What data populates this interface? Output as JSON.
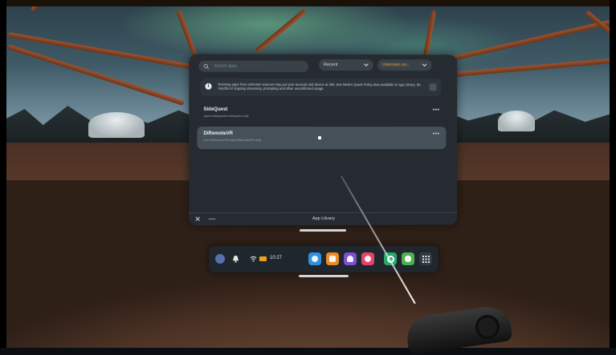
{
  "search": {
    "placeholder": "Search apps"
  },
  "sort_dropdown": {
    "selected": "Recent"
  },
  "filter_dropdown": {
    "selected": "Unknown so..."
  },
  "notice": {
    "text": "Running apps from unknown sources may put your account and device at risk. See Meta's Quest Policy also available in App Library. Be mindful of ongoing streaming, prompting and other unconfirmed usage."
  },
  "apps": [
    {
      "name": "SideQuest",
      "package": "quest.sidequestvr.sidequest.unity",
      "more": "•••"
    },
    {
      "name": "DiRemoteVR",
      "package": "com.DiRemoteVR.unity.DiRemoteVR.unity",
      "more": "•••"
    }
  ],
  "panel_footer": {
    "close": "✕",
    "minimize": "—",
    "title": "App Library"
  },
  "taskbar": {
    "clock": "10:27",
    "apps": [
      {
        "name": "meta-store-icon",
        "color": "#2f8fe0"
      },
      {
        "name": "explore-icon",
        "color": "#e98a2a"
      },
      {
        "name": "people-icon",
        "color": "#7a4fd0"
      },
      {
        "name": "camera-icon",
        "color": "#e0456a"
      },
      {
        "name": "browser-icon",
        "color": "#2aa86a"
      },
      {
        "name": "sidequest-icon",
        "color": "#4caf50"
      }
    ]
  }
}
